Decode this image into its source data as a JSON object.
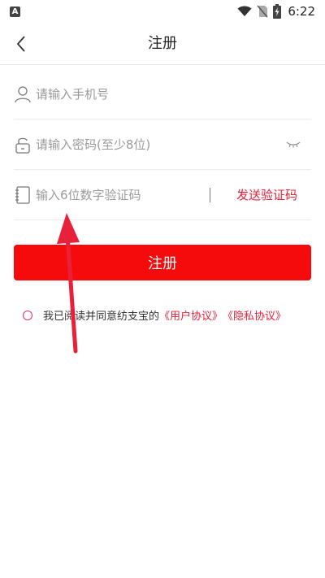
{
  "status_bar": {
    "app_badge": "A",
    "time": "6:22"
  },
  "nav": {
    "title": "注册"
  },
  "form": {
    "phone_placeholder": "请输入手机号",
    "password_placeholder": "请输入密码(至少8位)",
    "code_placeholder": "输入6位数字验证码",
    "send_code_label": "发送验证码"
  },
  "submit_label": "注册",
  "agreement": {
    "text": "我已阅读并同意纺支宝的",
    "user_agreement": "《用户协议》",
    "privacy_agreement": "《隐私协议》"
  },
  "colors": {
    "primary": "#f50b0b",
    "link": "#e8203a",
    "annotation_arrow": "#e8203a"
  }
}
